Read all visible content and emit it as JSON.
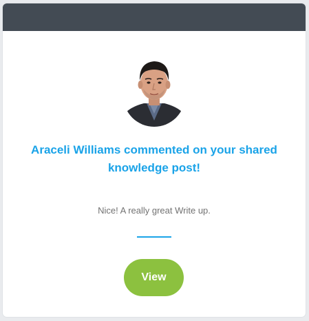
{
  "notification": {
    "headline": "Araceli Williams commented on your shared knowledge post!",
    "comment": "Nice! A really great Write up.",
    "view_label": "View"
  },
  "colors": {
    "header": "#434b54",
    "accent": "#1aa3e8",
    "button": "#8cc13f",
    "comment_text": "#727272"
  },
  "icons": {
    "avatar": "user-photo"
  }
}
